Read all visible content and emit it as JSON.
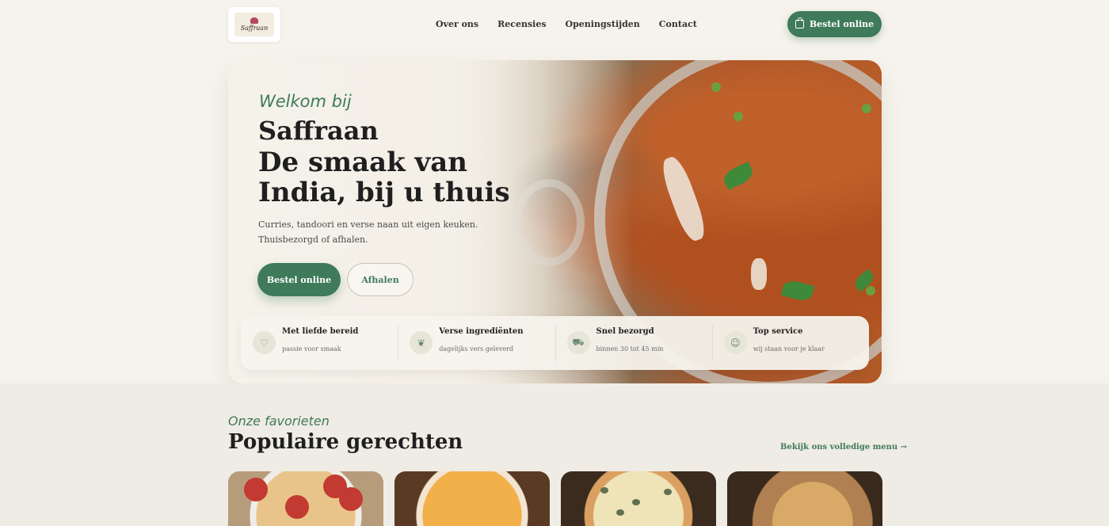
{
  "header": {
    "logo_text": "Saffraan",
    "nav": [
      "Over ons",
      "Recensies",
      "Openingstijden",
      "Contact"
    ],
    "order_button": "Bestel online"
  },
  "hero": {
    "welcome": "Welkom bij",
    "brand": "Saffraan",
    "headline": "De smaak van India, bij u thuis",
    "subtitle": "Curries, tandoori en verse naan uit eigen keuken. Thuisbezorgd of afhalen.",
    "primary_button": "Bestel online",
    "secondary_button": "Afhalen"
  },
  "features": [
    {
      "icon": "heart-icon",
      "title": "Met liefde bereid",
      "subtitle": "passie voor smaak"
    },
    {
      "icon": "leaf-icon",
      "title": "Verse ingrediënten",
      "subtitle": "dagelijks vers geleverd"
    },
    {
      "icon": "truck-icon",
      "title": "Snel bezorgd",
      "subtitle": "binnen 30 tot 45 min"
    },
    {
      "icon": "smile-icon",
      "title": "Top service",
      "subtitle": "wij staan voor je klaar"
    }
  ],
  "section": {
    "eyebrow": "Onze favorieten",
    "title": "Populaire gerechten",
    "menu_link": "Bekijk ons volledige menu →"
  },
  "colors": {
    "accent": "#3f7a5a",
    "background": "#f6f3ec"
  }
}
